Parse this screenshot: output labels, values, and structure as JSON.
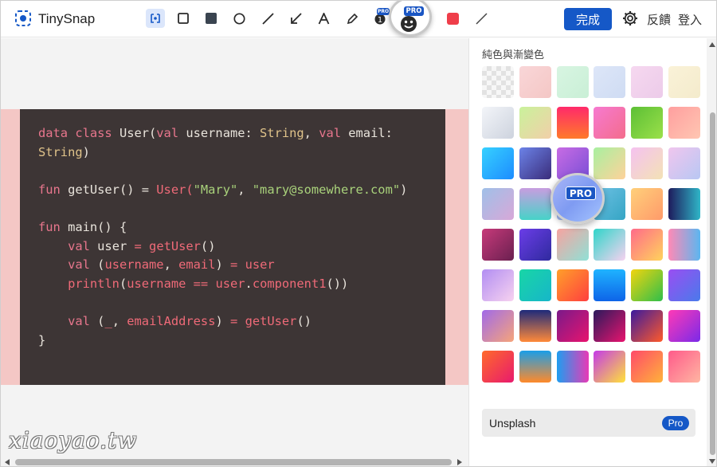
{
  "app": {
    "name": "TinySnap"
  },
  "toolbar": {
    "tools": [
      "background-tool",
      "rectangle-tool",
      "filled-rectangle-tool",
      "circle-tool",
      "line-tool",
      "arrow-tool",
      "text-tool",
      "pen-tool",
      "step-number-tool",
      "emoji-tool"
    ],
    "active_tool": "background-tool",
    "pro_badge": "PRO",
    "current_color": "#ef3e4a"
  },
  "header": {
    "done_label": "完成",
    "feedback_label": "反饋",
    "login_label": "登入"
  },
  "code": {
    "background": "#3d3535",
    "lines": [
      [
        [
          "kw",
          "data class "
        ],
        [
          "pl",
          "User("
        ],
        [
          "kw",
          "val "
        ],
        [
          "pl",
          "username: "
        ],
        [
          "ty",
          "String"
        ],
        [
          "pl",
          ", "
        ],
        [
          "kw",
          "val "
        ],
        [
          "pl",
          "email:"
        ]
      ],
      [
        [
          "ty",
          "String"
        ],
        [
          "pl",
          ")"
        ]
      ],
      [],
      [
        [
          "kw",
          "fun "
        ],
        [
          "pl",
          "getUser() = "
        ],
        [
          "fn",
          "User("
        ],
        [
          "st",
          "\"Mary\""
        ],
        [
          "pl",
          ", "
        ],
        [
          "st",
          "\"mary@somewhere.com\""
        ],
        [
          "pl",
          ")"
        ]
      ],
      [],
      [
        [
          "kw",
          "fun "
        ],
        [
          "pl",
          "main() {"
        ]
      ],
      [
        [
          "pl",
          "    "
        ],
        [
          "kw",
          "val "
        ],
        [
          "pl",
          "user "
        ],
        [
          "pr",
          "= "
        ],
        [
          "fn",
          "getUser"
        ],
        [
          "pl",
          "()"
        ]
      ],
      [
        [
          "pl",
          "    "
        ],
        [
          "kw",
          "val "
        ],
        [
          "pl",
          "("
        ],
        [
          "fn",
          "username"
        ],
        [
          "pl",
          ", "
        ],
        [
          "fn",
          "email"
        ],
        [
          "pl",
          ") "
        ],
        [
          "pr",
          "= "
        ],
        [
          "fn",
          "user"
        ]
      ],
      [
        [
          "pl",
          "    "
        ],
        [
          "fn",
          "println"
        ],
        [
          "pl",
          "("
        ],
        [
          "fn",
          "username "
        ],
        [
          "pr",
          "== "
        ],
        [
          "fn",
          "user"
        ],
        [
          "pl",
          "."
        ],
        [
          "fn",
          "component1"
        ],
        [
          "pl",
          "())"
        ]
      ],
      [],
      [
        [
          "pl",
          "    "
        ],
        [
          "kw",
          "val "
        ],
        [
          "pl",
          "("
        ],
        [
          "fn",
          "_"
        ],
        [
          "pl",
          ", "
        ],
        [
          "fn",
          "emailAddress"
        ],
        [
          "pl",
          ") "
        ],
        [
          "pr",
          "= "
        ],
        [
          "fn",
          "getUser"
        ],
        [
          "pl",
          "()"
        ]
      ],
      [
        [
          "pl",
          "}"
        ]
      ]
    ]
  },
  "panel": {
    "title": "純色與漸變色",
    "unsplash_label": "Unsplash",
    "unsplash_badge": "Pro",
    "lens_badge": "PRO",
    "swatches": [
      "transparent",
      "linear-gradient(135deg,#f9d6d8,#f4c7c5)",
      "linear-gradient(135deg,#d8f5e2,#c9efd6)",
      "linear-gradient(135deg,#dde6f8,#cfdcf3)",
      "linear-gradient(135deg,#f6d8f0,#eccbe9)",
      "linear-gradient(135deg,#faf2d8,#f4ebcc)",
      "linear-gradient(135deg,#f3f5f9,#cdd3de)",
      "linear-gradient(135deg,#c9f29b,#f2cfa9)",
      "linear-gradient(180deg,#ff2a6a,#ff7a2a)",
      "linear-gradient(135deg,#f67ad0,#f46c8c)",
      "linear-gradient(135deg,#5cbf35,#9be04a)",
      "linear-gradient(135deg,#ff9f9f,#ffc6b2)",
      "linear-gradient(135deg,#36d1ff,#1d8cff)",
      "linear-gradient(135deg,#6c83e8,#3a2c7a)",
      "linear-gradient(135deg,#c86ce4,#7a4fd6)",
      "linear-gradient(135deg,#a8f0a0,#ffd29a)",
      "linear-gradient(135deg,#f5c2f0,#f3e2b5)",
      "linear-gradient(135deg,#f0c6ee,#b8c7f3)",
      "linear-gradient(135deg,#9fc0e8,#d8a8d8)",
      "linear-gradient(180deg,#c89de0,#46d3c8)",
      "linear-gradient(135deg,#a7b8f7,#a4c4ff)",
      "linear-gradient(135deg,#6ec1e4,#35a5c4)",
      "linear-gradient(135deg,#ffd07a,#ff9a6a)",
      "linear-gradient(90deg,#1e1b5c,#2fb6c8)",
      "linear-gradient(135deg,#c73a7a,#6a2050)",
      "linear-gradient(135deg,#6b3de8,#2f2a9e)",
      "linear-gradient(135deg,#f7a3a0,#8fe1d6)",
      "linear-gradient(135deg,#2fd5c9,#f7d2f0)",
      "linear-gradient(135deg,#ff6a8a,#ffd35c)",
      "linear-gradient(90deg,#ff8ab6,#5bb6f0)",
      "linear-gradient(135deg,#b28ef2,#f7d2f0)",
      "linear-gradient(135deg,#18d6a6,#17b6c9)",
      "linear-gradient(135deg,#ff9f2a,#ff3f3f)",
      "linear-gradient(180deg,#1fb3ff,#0e64e8)",
      "linear-gradient(135deg,#f2d40e,#2fbf4a)",
      "linear-gradient(135deg,#9a4ef2,#4a7aeb)",
      "linear-gradient(135deg,#a06ae8,#f6a47a)",
      "linear-gradient(180deg,#1e2a7a,#ff8a3a)",
      "linear-gradient(135deg,#7a1a8a,#e8146e)",
      "linear-gradient(135deg,#2a1a5c,#e8146e)",
      "linear-gradient(135deg,#3a1a9e,#ff5a2a)",
      "linear-gradient(135deg,#ff3ab6,#7a2ae8)",
      "linear-gradient(135deg,#ff6a2a,#e81a6e)",
      "linear-gradient(180deg,#1a9ee8,#ff8a2a)",
      "linear-gradient(90deg,#1e9ef0,#e83ab6)",
      "linear-gradient(135deg,#c43ae8,#ffe23a)",
      "linear-gradient(135deg,#ff4a6a,#ffb23a)",
      "linear-gradient(135deg,#ff5a8a,#ffb6a2)"
    ]
  }
}
